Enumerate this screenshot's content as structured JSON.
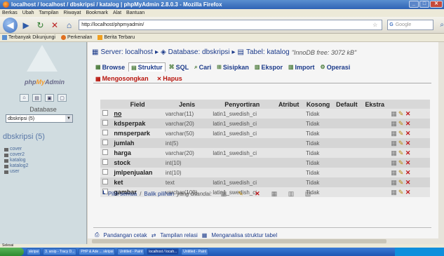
{
  "browser": {
    "title": "localhost / localhost / dbskripsi / katalog | phpMyAdmin 2.8.0.3 - Mozilla Firefox",
    "menu": [
      "Berkas",
      "Ubah",
      "Tampilan",
      "Riwayat",
      "Bookmark",
      "Alat",
      "Bantuan"
    ],
    "url": "http://localhost/phpmyadmin/",
    "search_placeholder": "Google",
    "bookmarks": [
      "Terbanyak Dikunjungi",
      "Perkenalan",
      "Berita Terbaru"
    ],
    "status": "Selesai"
  },
  "sidebar": {
    "logo_php": "php",
    "logo_my": "My",
    "logo_admin": "Admin",
    "icons": [
      "home-icon",
      "sql-window-icon",
      "query-icon",
      "docs-icon"
    ],
    "database_label": "Database",
    "database_select": "dbskripsi (5)",
    "db_name": "dbskripsi (5)",
    "tables": [
      "cover",
      "cover2",
      "katalog",
      "katalog2",
      "user"
    ]
  },
  "main": {
    "breadcrumb": {
      "server": "Server: localhost",
      "database": "Database: dbskripsi",
      "table": "Tabel: katalog",
      "info": "\"InnoDB free: 3072 kB\""
    },
    "tabs": [
      "Browse",
      "Struktur",
      "SQL",
      "Cari",
      "Sisipkan",
      "Ekspor",
      "Import",
      "Operasi"
    ],
    "active_tab": "Struktur",
    "tabs2": [
      "Mengosongkan",
      "Hapus"
    ],
    "columns": [
      "",
      "Field",
      "Jenis",
      "Penyortiran",
      "Atribut",
      "Kosong",
      "Default",
      "Ekstra"
    ],
    "rows": [
      {
        "field": "no",
        "type": "varchar(11)",
        "collation": "latin1_swedish_ci",
        "attr": "",
        "null": "Tidak",
        "default": "",
        "extra": ""
      },
      {
        "field": "kdsperpak",
        "type": "varchar(20)",
        "collation": "latin1_swedish_ci",
        "attr": "",
        "null": "Tidak",
        "default": "",
        "extra": ""
      },
      {
        "field": "nmsperpark",
        "type": "varchar(50)",
        "collation": "latin1_swedish_ci",
        "attr": "",
        "null": "Tidak",
        "default": "",
        "extra": ""
      },
      {
        "field": "jumlah",
        "type": "int(5)",
        "collation": "",
        "attr": "",
        "null": "Tidak",
        "default": "",
        "extra": ""
      },
      {
        "field": "harga",
        "type": "varchar(20)",
        "collation": "latin1_swedish_ci",
        "attr": "",
        "null": "Tidak",
        "default": "",
        "extra": ""
      },
      {
        "field": "stock",
        "type": "int(10)",
        "collation": "",
        "attr": "",
        "null": "Tidak",
        "default": "",
        "extra": ""
      },
      {
        "field": "jmlpenjualan",
        "type": "int(10)",
        "collation": "",
        "attr": "",
        "null": "Tidak",
        "default": "",
        "extra": ""
      },
      {
        "field": "ket",
        "type": "text",
        "collation": "latin1_swedish_ci",
        "attr": "",
        "null": "Tidak",
        "default": "",
        "extra": ""
      },
      {
        "field": "gambar",
        "type": "varchar(100)",
        "collation": "latin1_swedish_ci",
        "attr": "",
        "null": "Tidak",
        "default": "",
        "extra": ""
      }
    ],
    "select_all": "Pilih semua",
    "select_sep": "/",
    "invert": "Balik pilihan",
    "selected_label": "yang ditandai:",
    "bottom_links": [
      "Pandangan cetak",
      "Tampilan relasi",
      "Menganalisa struktur tabel"
    ]
  },
  "taskbar": {
    "tasks": [
      "skripsi",
      "3. arsip - Tracy D...",
      "PHP & Ade ... skripsi",
      "Untitled - Paint",
      "localhost / locah...",
      "Untitled - Paint"
    ],
    "tray_time": ""
  }
}
